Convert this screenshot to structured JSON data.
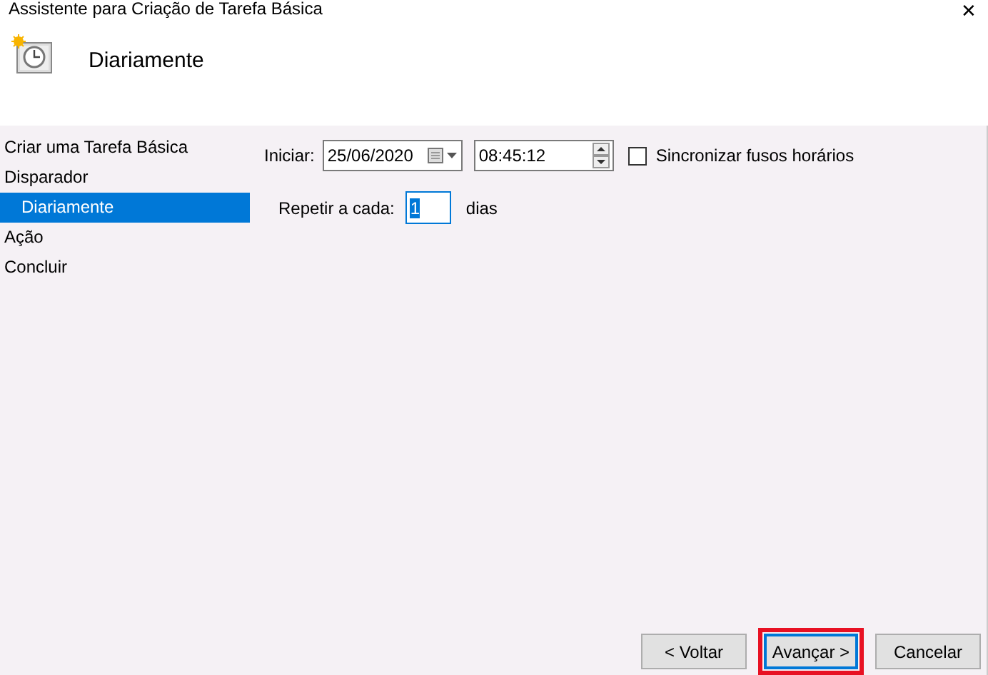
{
  "window": {
    "title": "Assistente para Criação de Tarefa Básica",
    "close": "✕"
  },
  "header": {
    "title": "Diariamente"
  },
  "sidebar": {
    "items": [
      {
        "label": "Criar uma Tarefa Básica",
        "selected": false
      },
      {
        "label": "Disparador",
        "selected": false,
        "children": [
          {
            "label": "Diariamente",
            "selected": true
          }
        ]
      },
      {
        "label": "Ação",
        "selected": false
      },
      {
        "label": "Concluir",
        "selected": false
      }
    ]
  },
  "form": {
    "start_label": "Iniciar:",
    "date": "25/06/2020",
    "time": "08:45:12",
    "sync": {
      "label": "Sincronizar fusos horários",
      "checked": false
    },
    "repeat_label": "Repetir a cada:",
    "repeat_value": "1",
    "repeat_unit": "dias"
  },
  "buttons": [
    {
      "label": "< Voltar",
      "highlighted": false
    },
    {
      "label": "Avançar >",
      "highlighted": true
    },
    {
      "label": "Cancelar",
      "highlighted": false
    }
  ]
}
